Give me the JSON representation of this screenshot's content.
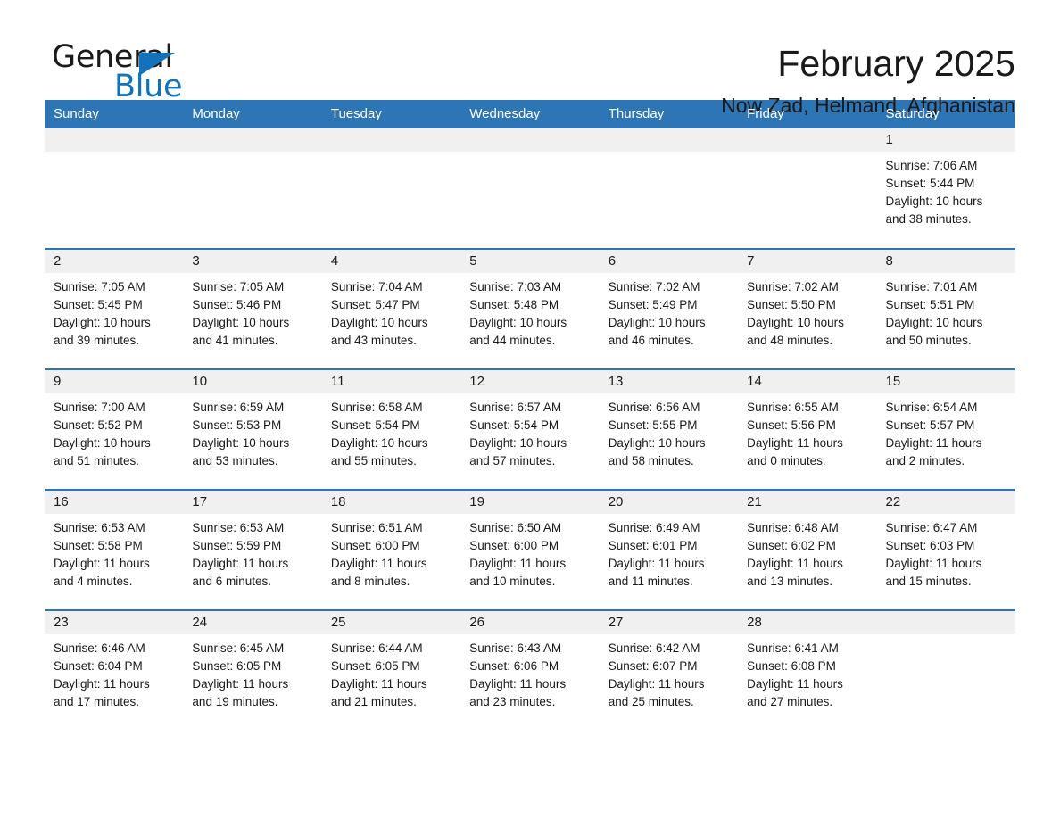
{
  "brand": {
    "word1": "General",
    "word2": "Blue",
    "triangle_color": "#1272bb"
  },
  "header": {
    "title": "February 2025",
    "subtitle": "Now Zad, Helmand, Afghanistan"
  },
  "theme": {
    "header_blue": "#2e75b6",
    "daynum_band": "#f0f0f0",
    "text": "#1a1a1a",
    "brand_blue": "#1272bb"
  },
  "weekday_headers": [
    "Sunday",
    "Monday",
    "Tuesday",
    "Wednesday",
    "Thursday",
    "Friday",
    "Saturday"
  ],
  "labels": {
    "sunrise_prefix": "Sunrise: ",
    "sunset_prefix": "Sunset: ",
    "daylight_prefix": "Daylight: "
  },
  "weeks": [
    [
      {
        "day": "",
        "sunrise": "",
        "sunset": "",
        "daylight_line1": "",
        "daylight_line2": ""
      },
      {
        "day": "",
        "sunrise": "",
        "sunset": "",
        "daylight_line1": "",
        "daylight_line2": ""
      },
      {
        "day": "",
        "sunrise": "",
        "sunset": "",
        "daylight_line1": "",
        "daylight_line2": ""
      },
      {
        "day": "",
        "sunrise": "",
        "sunset": "",
        "daylight_line1": "",
        "daylight_line2": ""
      },
      {
        "day": "",
        "sunrise": "",
        "sunset": "",
        "daylight_line1": "",
        "daylight_line2": ""
      },
      {
        "day": "",
        "sunrise": "",
        "sunset": "",
        "daylight_line1": "",
        "daylight_line2": ""
      },
      {
        "day": "1",
        "sunrise": "Sunrise: 7:06 AM",
        "sunset": "Sunset: 5:44 PM",
        "daylight_line1": "Daylight: 10 hours",
        "daylight_line2": "and 38 minutes."
      }
    ],
    [
      {
        "day": "2",
        "sunrise": "Sunrise: 7:05 AM",
        "sunset": "Sunset: 5:45 PM",
        "daylight_line1": "Daylight: 10 hours",
        "daylight_line2": "and 39 minutes."
      },
      {
        "day": "3",
        "sunrise": "Sunrise: 7:05 AM",
        "sunset": "Sunset: 5:46 PM",
        "daylight_line1": "Daylight: 10 hours",
        "daylight_line2": "and 41 minutes."
      },
      {
        "day": "4",
        "sunrise": "Sunrise: 7:04 AM",
        "sunset": "Sunset: 5:47 PM",
        "daylight_line1": "Daylight: 10 hours",
        "daylight_line2": "and 43 minutes."
      },
      {
        "day": "5",
        "sunrise": "Sunrise: 7:03 AM",
        "sunset": "Sunset: 5:48 PM",
        "daylight_line1": "Daylight: 10 hours",
        "daylight_line2": "and 44 minutes."
      },
      {
        "day": "6",
        "sunrise": "Sunrise: 7:02 AM",
        "sunset": "Sunset: 5:49 PM",
        "daylight_line1": "Daylight: 10 hours",
        "daylight_line2": "and 46 minutes."
      },
      {
        "day": "7",
        "sunrise": "Sunrise: 7:02 AM",
        "sunset": "Sunset: 5:50 PM",
        "daylight_line1": "Daylight: 10 hours",
        "daylight_line2": "and 48 minutes."
      },
      {
        "day": "8",
        "sunrise": "Sunrise: 7:01 AM",
        "sunset": "Sunset: 5:51 PM",
        "daylight_line1": "Daylight: 10 hours",
        "daylight_line2": "and 50 minutes."
      }
    ],
    [
      {
        "day": "9",
        "sunrise": "Sunrise: 7:00 AM",
        "sunset": "Sunset: 5:52 PM",
        "daylight_line1": "Daylight: 10 hours",
        "daylight_line2": "and 51 minutes."
      },
      {
        "day": "10",
        "sunrise": "Sunrise: 6:59 AM",
        "sunset": "Sunset: 5:53 PM",
        "daylight_line1": "Daylight: 10 hours",
        "daylight_line2": "and 53 minutes."
      },
      {
        "day": "11",
        "sunrise": "Sunrise: 6:58 AM",
        "sunset": "Sunset: 5:54 PM",
        "daylight_line1": "Daylight: 10 hours",
        "daylight_line2": "and 55 minutes."
      },
      {
        "day": "12",
        "sunrise": "Sunrise: 6:57 AM",
        "sunset": "Sunset: 5:54 PM",
        "daylight_line1": "Daylight: 10 hours",
        "daylight_line2": "and 57 minutes."
      },
      {
        "day": "13",
        "sunrise": "Sunrise: 6:56 AM",
        "sunset": "Sunset: 5:55 PM",
        "daylight_line1": "Daylight: 10 hours",
        "daylight_line2": "and 58 minutes."
      },
      {
        "day": "14",
        "sunrise": "Sunrise: 6:55 AM",
        "sunset": "Sunset: 5:56 PM",
        "daylight_line1": "Daylight: 11 hours",
        "daylight_line2": "and 0 minutes."
      },
      {
        "day": "15",
        "sunrise": "Sunrise: 6:54 AM",
        "sunset": "Sunset: 5:57 PM",
        "daylight_line1": "Daylight: 11 hours",
        "daylight_line2": "and 2 minutes."
      }
    ],
    [
      {
        "day": "16",
        "sunrise": "Sunrise: 6:53 AM",
        "sunset": "Sunset: 5:58 PM",
        "daylight_line1": "Daylight: 11 hours",
        "daylight_line2": "and 4 minutes."
      },
      {
        "day": "17",
        "sunrise": "Sunrise: 6:53 AM",
        "sunset": "Sunset: 5:59 PM",
        "daylight_line1": "Daylight: 11 hours",
        "daylight_line2": "and 6 minutes."
      },
      {
        "day": "18",
        "sunrise": "Sunrise: 6:51 AM",
        "sunset": "Sunset: 6:00 PM",
        "daylight_line1": "Daylight: 11 hours",
        "daylight_line2": "and 8 minutes."
      },
      {
        "day": "19",
        "sunrise": "Sunrise: 6:50 AM",
        "sunset": "Sunset: 6:00 PM",
        "daylight_line1": "Daylight: 11 hours",
        "daylight_line2": "and 10 minutes."
      },
      {
        "day": "20",
        "sunrise": "Sunrise: 6:49 AM",
        "sunset": "Sunset: 6:01 PM",
        "daylight_line1": "Daylight: 11 hours",
        "daylight_line2": "and 11 minutes."
      },
      {
        "day": "21",
        "sunrise": "Sunrise: 6:48 AM",
        "sunset": "Sunset: 6:02 PM",
        "daylight_line1": "Daylight: 11 hours",
        "daylight_line2": "and 13 minutes."
      },
      {
        "day": "22",
        "sunrise": "Sunrise: 6:47 AM",
        "sunset": "Sunset: 6:03 PM",
        "daylight_line1": "Daylight: 11 hours",
        "daylight_line2": "and 15 minutes."
      }
    ],
    [
      {
        "day": "23",
        "sunrise": "Sunrise: 6:46 AM",
        "sunset": "Sunset: 6:04 PM",
        "daylight_line1": "Daylight: 11 hours",
        "daylight_line2": "and 17 minutes."
      },
      {
        "day": "24",
        "sunrise": "Sunrise: 6:45 AM",
        "sunset": "Sunset: 6:05 PM",
        "daylight_line1": "Daylight: 11 hours",
        "daylight_line2": "and 19 minutes."
      },
      {
        "day": "25",
        "sunrise": "Sunrise: 6:44 AM",
        "sunset": "Sunset: 6:05 PM",
        "daylight_line1": "Daylight: 11 hours",
        "daylight_line2": "and 21 minutes."
      },
      {
        "day": "26",
        "sunrise": "Sunrise: 6:43 AM",
        "sunset": "Sunset: 6:06 PM",
        "daylight_line1": "Daylight: 11 hours",
        "daylight_line2": "and 23 minutes."
      },
      {
        "day": "27",
        "sunrise": "Sunrise: 6:42 AM",
        "sunset": "Sunset: 6:07 PM",
        "daylight_line1": "Daylight: 11 hours",
        "daylight_line2": "and 25 minutes."
      },
      {
        "day": "28",
        "sunrise": "Sunrise: 6:41 AM",
        "sunset": "Sunset: 6:08 PM",
        "daylight_line1": "Daylight: 11 hours",
        "daylight_line2": "and 27 minutes."
      },
      {
        "day": "",
        "sunrise": "",
        "sunset": "",
        "daylight_line1": "",
        "daylight_line2": ""
      }
    ]
  ]
}
